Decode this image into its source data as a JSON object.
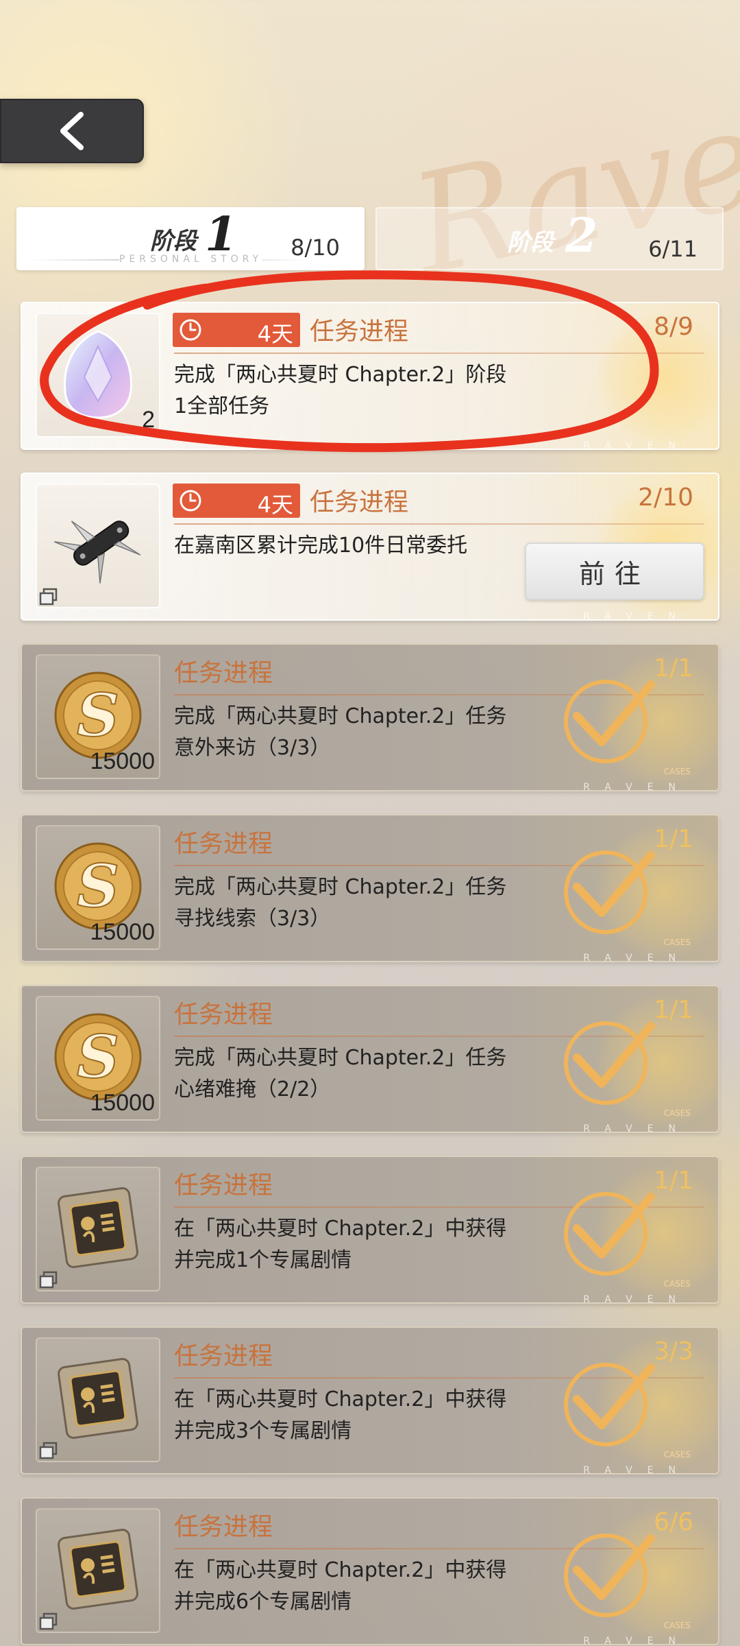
{
  "header": {
    "back_label": "<",
    "watermark": "Raven"
  },
  "tabs": [
    {
      "label": "阶段",
      "number": "1",
      "progress": "8/10",
      "sub": "PERSONAL STORY",
      "active": true
    },
    {
      "label": "阶段",
      "number": "2",
      "progress": "6/11",
      "sub": "",
      "active": false
    }
  ],
  "tasks": [
    {
      "icon": "crystal-icon",
      "count": "2",
      "timer_days": "4天",
      "title": "任务进程",
      "progress": "8/9",
      "desc_lines": [
        "完成「两心共夏时 Chapter.2」阶段",
        "1全部任务"
      ],
      "status": "open"
    },
    {
      "icon": "pocket-knife-icon",
      "count": "",
      "timer_days": "4天",
      "title": "任务进程",
      "progress": "2/10",
      "desc_lines": [
        "在嘉南区累计完成10件日常委托"
      ],
      "button": "前往",
      "status": "open"
    },
    {
      "icon": "coin-icon",
      "count": "15000",
      "title": "任务进程",
      "progress": "1/1",
      "desc_lines": [
        "完成「两心共夏时 Chapter.2」任务",
        "意外来访（3/3）"
      ],
      "status": "done"
    },
    {
      "icon": "coin-icon",
      "count": "15000",
      "title": "任务进程",
      "progress": "1/1",
      "desc_lines": [
        "完成「两心共夏时 Chapter.2」任务",
        "寻找线索（3/3）"
      ],
      "status": "done"
    },
    {
      "icon": "coin-icon",
      "count": "15000",
      "title": "任务进程",
      "progress": "1/1",
      "desc_lines": [
        "完成「两心共夏时 Chapter.2」任务",
        "心绪难掩（2/2）"
      ],
      "status": "done"
    },
    {
      "icon": "chip-card-icon",
      "count": "",
      "title": "任务进程",
      "progress": "1/1",
      "desc_lines": [
        "在「两心共夏时 Chapter.2」中获得",
        "并完成1个专属剧情"
      ],
      "status": "done"
    },
    {
      "icon": "chip-card-icon",
      "count": "",
      "title": "任务进程",
      "progress": "3/3",
      "desc_lines": [
        "在「两心共夏时 Chapter.2」中获得",
        "并完成3个专属剧情"
      ],
      "status": "done"
    },
    {
      "icon": "chip-card-icon",
      "count": "",
      "title": "任务进程",
      "progress": "6/6",
      "desc_lines": [
        "在「两心共夏时 Chapter.2」中获得",
        "并完成6个专属剧情"
      ],
      "status": "done"
    }
  ],
  "card_footer": "RAVEN",
  "card_tag": "CASES",
  "colors": {
    "accent": "#c8733d",
    "timer": "#e25a3a",
    "check": "#f0b45a",
    "annotation": "#e8321e"
  }
}
